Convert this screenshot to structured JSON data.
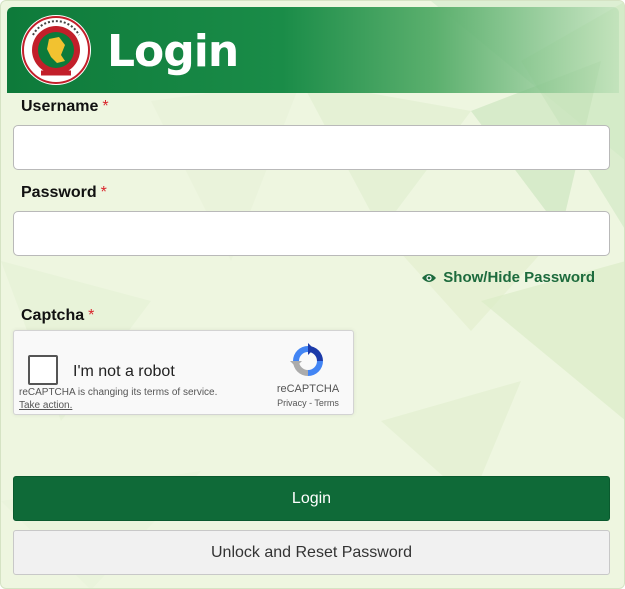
{
  "header": {
    "title": "Login",
    "logo_icon": "bangladesh-government-seal",
    "colors": {
      "header_dark": "#0e7a3a",
      "header_light": "#5cb06e"
    }
  },
  "form": {
    "username_label": "Username",
    "password_label": "Password",
    "captcha_label": "Captcha",
    "required_mark": "*",
    "username_value": "",
    "password_value": "",
    "show_hide_label": "Show/Hide Password",
    "show_hide_icon": "eye-icon"
  },
  "recaptcha": {
    "checkbox_label": "I'm not a robot",
    "notice": "reCAPTCHA is changing its terms of service.",
    "action": "Take action.",
    "brand": "reCAPTCHA",
    "privacy": "Privacy",
    "separator": " - ",
    "terms": "Terms"
  },
  "buttons": {
    "login": "Login",
    "unlock": "Unlock and Reset Password"
  },
  "colors": {
    "primary": "#0f6a38",
    "required": "#d9242b",
    "link": "#1d6b3d",
    "panel_bg": "#eef6e0"
  }
}
